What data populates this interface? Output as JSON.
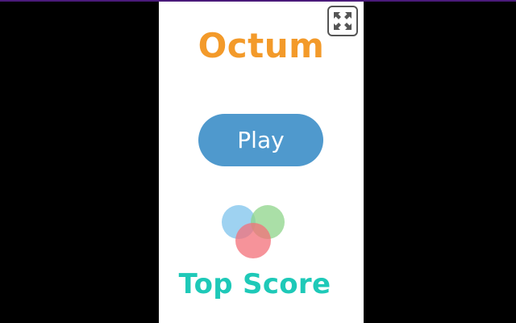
{
  "game": {
    "title": "Octum",
    "play_label": "Play",
    "top_score_label": "Top Score"
  },
  "icons": {
    "fullscreen": "fullscreen-arrows-icon",
    "logo": "three-overlapping-circles-icon"
  },
  "colors": {
    "title": "#f39a2a",
    "play_button": "#4f99cd",
    "top_score": "#1ec9b8",
    "circle_blue": "#7ec3ec",
    "circle_green": "#8ed48a",
    "circle_red": "#f36f78"
  }
}
